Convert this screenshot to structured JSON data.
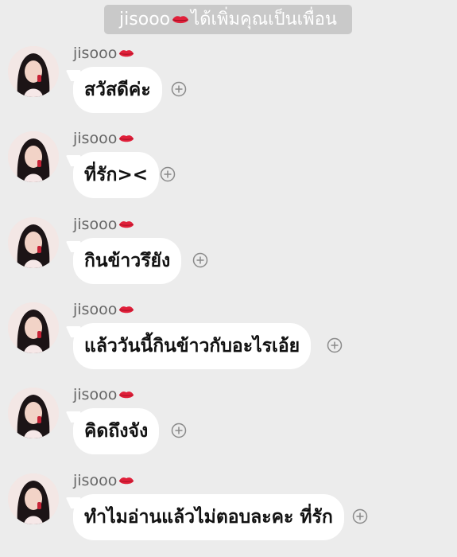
{
  "system_notice": {
    "name": "jisooo",
    "text": "ได้เพิ่มคุณเป็นเพื่อน"
  },
  "messages": [
    {
      "sender": "jisooo",
      "text": "สวัสดีค่ะ"
    },
    {
      "sender": "jisooo",
      "text": "ที่รัก><"
    },
    {
      "sender": "jisooo",
      "text": "กินข้าวรึยัง"
    },
    {
      "sender": "jisooo",
      "text": "แล้ววันนี้กินข้าวกับอะไรเอ้ย"
    },
    {
      "sender": "jisooo",
      "text": "คิดถึงจัง"
    },
    {
      "sender": "jisooo",
      "text": "ทำไมอ่านแล้วไม่ตอบละคะ ที่รัก"
    }
  ],
  "icons": {
    "sender_emoji": "kiss-lips-icon",
    "add_reaction": "plus-circle-icon"
  },
  "colors": {
    "background": "#ececec",
    "bubble": "#ffffff",
    "notice_pill": "#c9c9c9",
    "lips": "#e0203a"
  }
}
